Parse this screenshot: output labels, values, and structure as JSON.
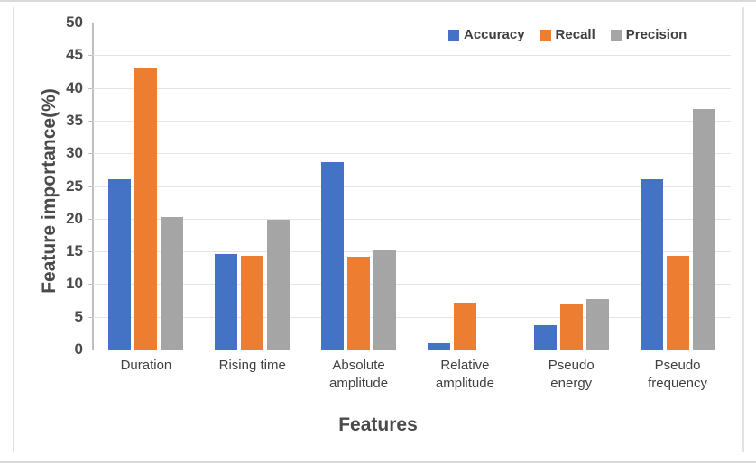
{
  "chart_data": {
    "type": "bar",
    "title": "",
    "xlabel": "Features",
    "ylabel": "Feature importance(%)",
    "categories": [
      "Duration",
      "Rising time",
      "Absolute\namplitude",
      "Relative\namplitude",
      "Pseudo\nenergy",
      "Pseudo\nfrequency"
    ],
    "series": [
      {
        "name": "Accuracy",
        "color": "#4472C4",
        "values": [
          26.0,
          14.6,
          28.7,
          0.9,
          3.7,
          26.0
        ]
      },
      {
        "name": "Recall",
        "color": "#ED7D31",
        "values": [
          43.0,
          14.3,
          14.2,
          7.1,
          7.0,
          14.3
        ]
      },
      {
        "name": "Precision",
        "color": "#A5A5A5",
        "values": [
          20.2,
          19.8,
          15.3,
          0.0,
          7.7,
          36.8
        ]
      }
    ],
    "ylim": [
      0,
      50
    ],
    "yticks": [
      0,
      5,
      10,
      15,
      20,
      25,
      30,
      35,
      40,
      45,
      50
    ],
    "ytick_labels": [
      "0",
      "5",
      "10",
      "15",
      "20",
      "25",
      "30",
      "35",
      "40",
      "45",
      "50"
    ],
    "grid": true,
    "legend_position": "top-right"
  },
  "legend": {
    "items": [
      {
        "label": "Accuracy",
        "color": "#4472C4"
      },
      {
        "label": "Recall",
        "color": "#ED7D31"
      },
      {
        "label": "Precision",
        "color": "#A5A5A5"
      }
    ]
  }
}
